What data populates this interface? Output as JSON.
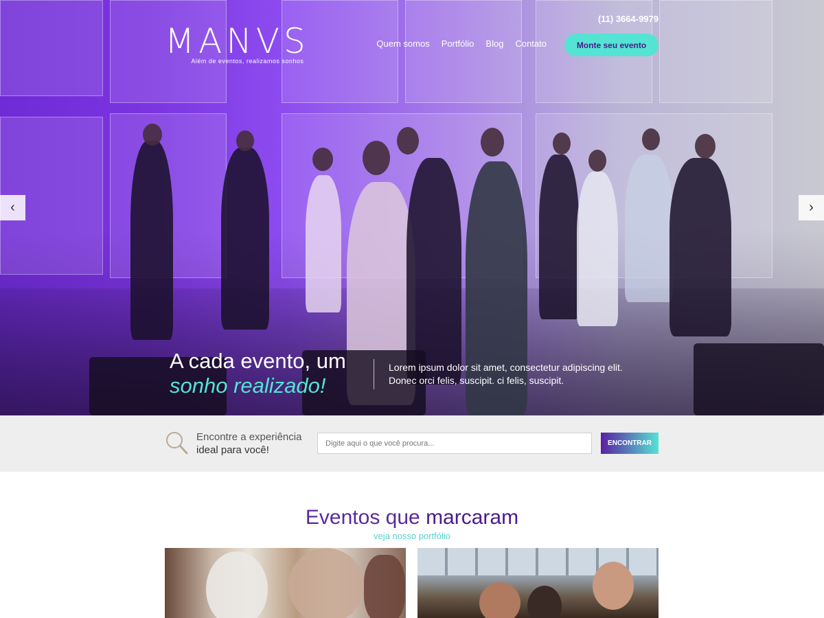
{
  "brand": {
    "name": "MANVS",
    "tagline": "Além de eventos, realizamos sonhos"
  },
  "header": {
    "phone": "(11) 3664-9979",
    "nav": [
      "Quem somos",
      "Portfólio",
      "Blog",
      "Contato"
    ],
    "cta": "Monte seu evento"
  },
  "hero": {
    "headline_line1": "A cada evento, um",
    "headline_line2": "sonho realizado!",
    "text_line1": "Lorem ipsum dolor sit amet, consectetur adipiscing elit.",
    "text_line2": "Donec orci felis, suscipit. ci felis, suscipit.",
    "prev_icon": "chevron-left-icon",
    "next_icon": "chevron-right-icon",
    "accent_color": "#55e3d3"
  },
  "search": {
    "label_line1": "Encontre a experiência",
    "label_line2": "ideal para você!",
    "placeholder": "Digite aqui o que você procura...",
    "button": "ENCONTRAR",
    "icon": "search-icon"
  },
  "portfolio": {
    "title_light": "Eventos que",
    "title_bold": "marcaram",
    "subtitle": "veja nosso portfólio"
  }
}
